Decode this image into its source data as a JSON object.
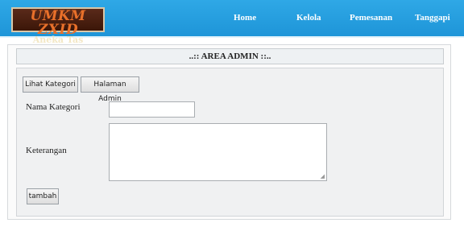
{
  "header": {
    "logo_main": "UMKM ZXID",
    "logo_sub": "Aneka Tas",
    "nav": [
      "Home",
      "Kelola",
      "Pemesanan",
      "Tanggapi"
    ]
  },
  "panel": {
    "title": "..:: AREA ADMIN ::.."
  },
  "form": {
    "buttons": {
      "lihat_kategori": "Lihat Kategori",
      "halaman_admin": "Halaman Admin",
      "tambah": "tambah"
    },
    "nama_kategori": {
      "label": "Nama Kategori",
      "value": ""
    },
    "keterangan": {
      "label": "Keterangan",
      "value": ""
    }
  },
  "colors": {
    "header_bg": "#2196d8",
    "logo_bg": "#3b1608",
    "logo_text": "#e8702a"
  }
}
